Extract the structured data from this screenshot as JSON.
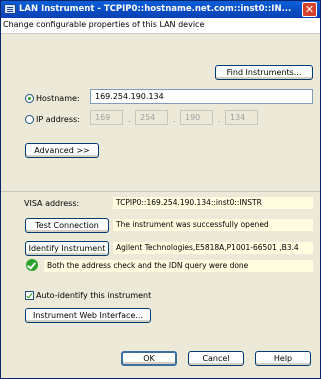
{
  "window": {
    "title": "LAN Instrument - TCPIP0::hostname.net.com::inst0::IN...",
    "close_label": "✕",
    "subtitle": "Change configurable properties of this LAN device"
  },
  "buttons": {
    "find_instruments": "Find Instruments...",
    "advanced": "Advanced >>",
    "test_connection": "Test Connection",
    "identify_instrument": "Identify Instrument",
    "web_interface": "Instrument Web Interface...",
    "ok": "OK",
    "cancel": "Cancel",
    "help": "Help"
  },
  "address": {
    "hostname_label": "Hostname:",
    "hostname_value": "169.254.190.134",
    "hostname_selected": true,
    "ip_label": "IP address:",
    "ip_octets": [
      "169",
      "254",
      "190",
      "134"
    ],
    "ip_selected": false
  },
  "visa": {
    "label": "VISA address:",
    "value": "TCPIP0::169.254.190.134::inst0::INSTR"
  },
  "results": {
    "test_connection": "The instrument was successfully opened",
    "identify": "Agilent Technologies,E5818A,P1001-66501 ,B3.4",
    "status": "Both the address check and the IDN query were done"
  },
  "auto_identify": {
    "label": "Auto-identify this instrument",
    "checked": true
  },
  "colors": {
    "titlebar": "#0a4fd0",
    "dialog_bg": "#ece9d8",
    "info_bg": "#fffce0",
    "success": "#29a329"
  }
}
